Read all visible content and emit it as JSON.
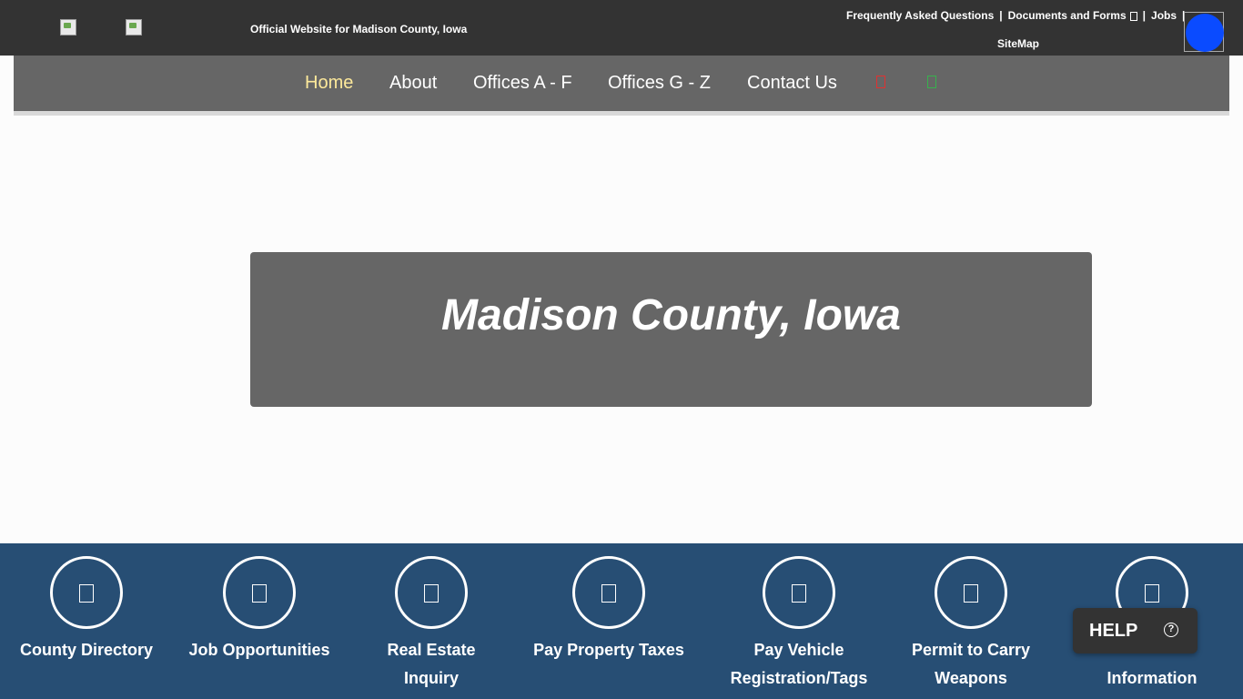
{
  "header": {
    "official_text": "Official Website for Madison County, Iowa",
    "links": {
      "faq": "Frequently Asked Questions",
      "sep1": "|",
      "documents": "Documents and Forms",
      "sep2": "|",
      "jobs": "Jobs",
      "sep3": "|",
      "sitemap": "SiteMap"
    },
    "logo_icons": [
      "broken-image-icon",
      "broken-image-icon"
    ],
    "accessibility_icon": "accessibility-icon",
    "accessibility_color": "#0a4bff"
  },
  "nav": {
    "items": [
      {
        "label": "Home",
        "active": true
      },
      {
        "label": "About"
      },
      {
        "label": "Offices A - F"
      },
      {
        "label": "Offices G - Z"
      },
      {
        "label": "Contact Us"
      }
    ],
    "icons": [
      {
        "name": "red-icon",
        "color": "#e03131"
      },
      {
        "name": "green-icon",
        "color": "#37b24d"
      }
    ],
    "active_color": "#fde99b"
  },
  "hero": {
    "title": "Madison County, Iowa"
  },
  "quick_links": [
    {
      "label": "County Directory",
      "icon": "directory-icon"
    },
    {
      "label": "Job Opportunities",
      "icon": "briefcase-icon"
    },
    {
      "label": "Real Estate Inquiry",
      "icon": "house-icon"
    },
    {
      "label": "Pay Property Taxes",
      "icon": "dollar-icon"
    },
    {
      "label": "Pay Vehicle Registration/Tags",
      "icon": "car-icon"
    },
    {
      "label": "Permit to Carry Weapons",
      "icon": "permit-icon"
    },
    {
      "label": "Information",
      "icon": "info-icon"
    }
  ],
  "help_widget": {
    "label": "HELP",
    "icon": "question-icon"
  },
  "colors": {
    "topbar": "#333333",
    "nav": "#666666",
    "quick_links_bg": "#274e74"
  }
}
